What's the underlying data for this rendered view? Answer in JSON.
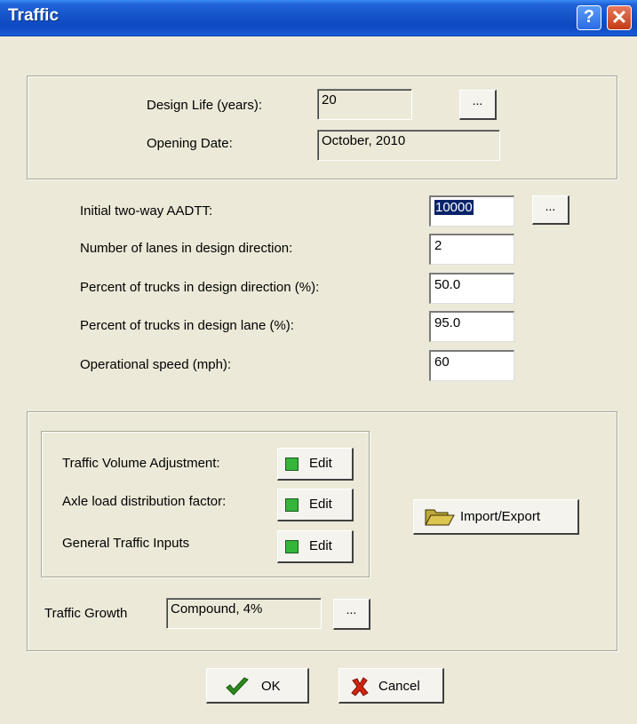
{
  "window": {
    "title": "Traffic",
    "help_glyph": "?",
    "close_glyph": "✕"
  },
  "top": {
    "design_life_label": "Design Life (years):",
    "design_life_value": "20",
    "opening_date_label": "Opening Date:",
    "opening_date_value": "October, 2010",
    "browse_label": "..."
  },
  "main": {
    "aadtt_label": "Initial two-way AADTT:",
    "aadtt_value": "10000",
    "lanes_label": "Number of lanes in design direction:",
    "lanes_value": "2",
    "pct_direction_label": "Percent of trucks in design direction (%):",
    "pct_direction_value": "50.0",
    "pct_lane_label": "Percent of trucks in design lane (%):",
    "pct_lane_value": "95.0",
    "speed_label": "Operational speed (mph):",
    "speed_value": "60",
    "browse_label": "..."
  },
  "adjust": {
    "volume_label": "Traffic Volume Adjustment:",
    "axle_label": "Axle load distribution factor:",
    "general_label": "General Traffic Inputs",
    "edit_label": "Edit",
    "import_export_label": "Import/Export",
    "growth_label": "Traffic Growth",
    "growth_value": "Compound, 4%",
    "browse_label": "..."
  },
  "footer": {
    "ok_label": "OK",
    "cancel_label": "Cancel"
  },
  "colors": {
    "title_bar": "#1553C8",
    "edit_indicator": "#35B53A",
    "ok_check": "#2E8B1E",
    "cancel_x": "#D1230F"
  }
}
